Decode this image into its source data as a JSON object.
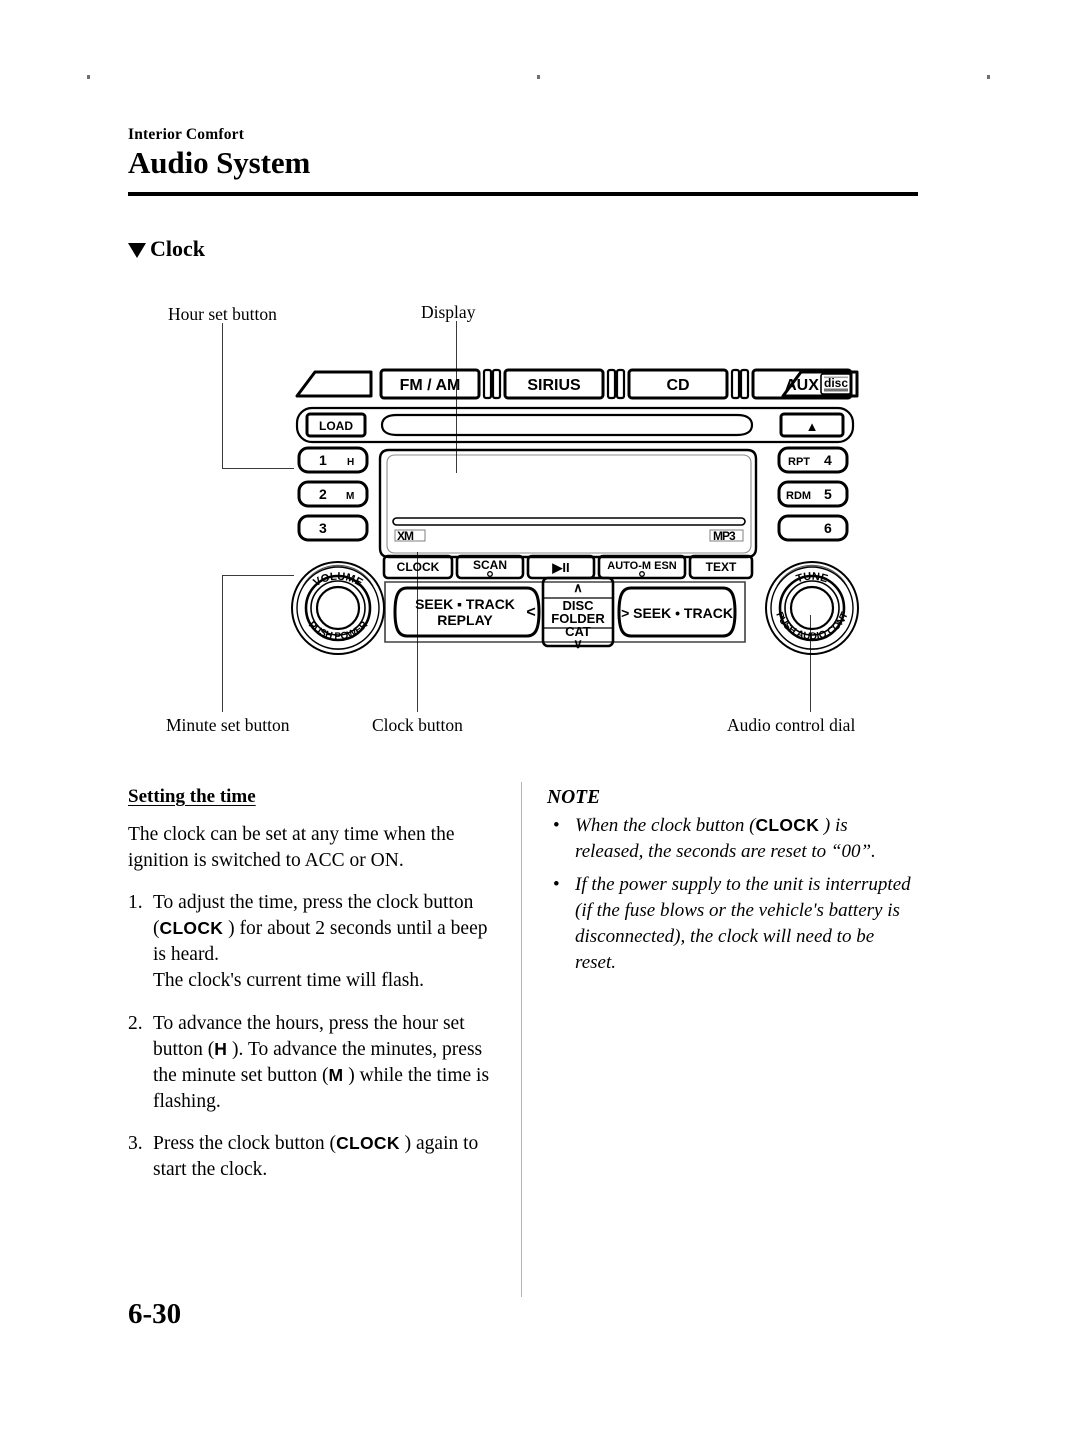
{
  "page": {
    "eyebrow": "Interior Comfort",
    "title": "Audio System",
    "number": "6-30"
  },
  "section": {
    "heading": "Clock"
  },
  "figure": {
    "callouts": {
      "hour_set": "Hour set button",
      "display": "Display",
      "minute_set": "Minute set button",
      "clock": "Clock button",
      "audio_dial": "Audio control dial"
    },
    "head_unit": {
      "source_buttons": [
        "FM / AM",
        "SIRIUS",
        "CD",
        "AUX"
      ],
      "disc_logo": "disc",
      "disc_logo_sub": "COMPACT DIGITAL AUDIO",
      "load_button": "LOAD",
      "eject_button": "▲",
      "presets_left": [
        {
          "number": "1",
          "sub": "H"
        },
        {
          "number": "2",
          "sub": "M"
        },
        {
          "number": "3",
          "sub": ""
        }
      ],
      "presets_right": [
        {
          "label": "RPT",
          "number": "4"
        },
        {
          "label": "RDM",
          "number": "5"
        },
        {
          "label": "",
          "number": "6"
        }
      ],
      "display_logo_left": "XM",
      "display_logo_right": "MP3",
      "function_buttons": [
        "CLOCK",
        "SCAN",
        "▶II",
        "AUTO-M  ESN",
        "TEXT"
      ],
      "left_knob_top": "VOLUME",
      "left_knob_bottom": "PUSH POWER",
      "right_knob_top": "TUNE",
      "right_knob_bottom": "PUSH AUDIO CONT",
      "seek_left_line1": "SEEK ▪ TRACK",
      "seek_left_line2": "REPLAY",
      "seek_right": "> SEEK • TRACK",
      "center_pad": [
        "DISC",
        "FOLDER",
        "CAT"
      ]
    }
  },
  "left_column": {
    "sub_title": "Setting the time",
    "intro": "The clock can be set at any time when the ignition is switched to ACC or ON.",
    "steps": [
      {
        "number": "1.",
        "part1": "To adjust the time, press the clock button (",
        "token": "CLOCK",
        "part2": " ) for about 2 seconds until a beep is heard.",
        "part3": "The clock's current time will flash."
      },
      {
        "number": "2.",
        "part1": "To advance the hours, press the hour set button (",
        "token": "H",
        "part2": " ). To advance the minutes, press the minute set button (",
        "token2": "M",
        "part3": " ) while the time is flashing."
      },
      {
        "number": "3.",
        "part1": "Press the clock button (",
        "token": "CLOCK",
        "part2": " ) again to start the clock."
      }
    ]
  },
  "right_column": {
    "note_title": "NOTE",
    "notes": [
      {
        "bullet": "•",
        "part1": "When the clock button (",
        "token": "CLOCK",
        "part2": " ) is released, the seconds are reset to “00”."
      },
      {
        "bullet": "•",
        "part1": "If the power supply to the unit is interrupted (if the fuse blows or the vehicle's battery is disconnected), the clock will need to be reset.",
        "token": "",
        "part2": ""
      }
    ]
  }
}
